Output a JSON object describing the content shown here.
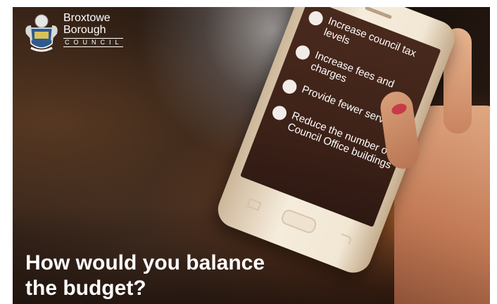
{
  "logo": {
    "line1": "Broxtowe",
    "line2": "Borough",
    "line3": "COUNCIL",
    "icon": "borough-crest-icon"
  },
  "phone": {
    "options": [
      {
        "label": "Increase council tax levels"
      },
      {
        "label": "Increase fees and charges"
      },
      {
        "label": "Provide fewer services"
      },
      {
        "label": "Reduce the number of Council Office buildings"
      }
    ]
  },
  "headline": {
    "line1": "How would you balance",
    "line2": "the budget?"
  },
  "colors": {
    "text": "#ffffff",
    "screen": "#3e2218",
    "nail": "#c83a45"
  }
}
